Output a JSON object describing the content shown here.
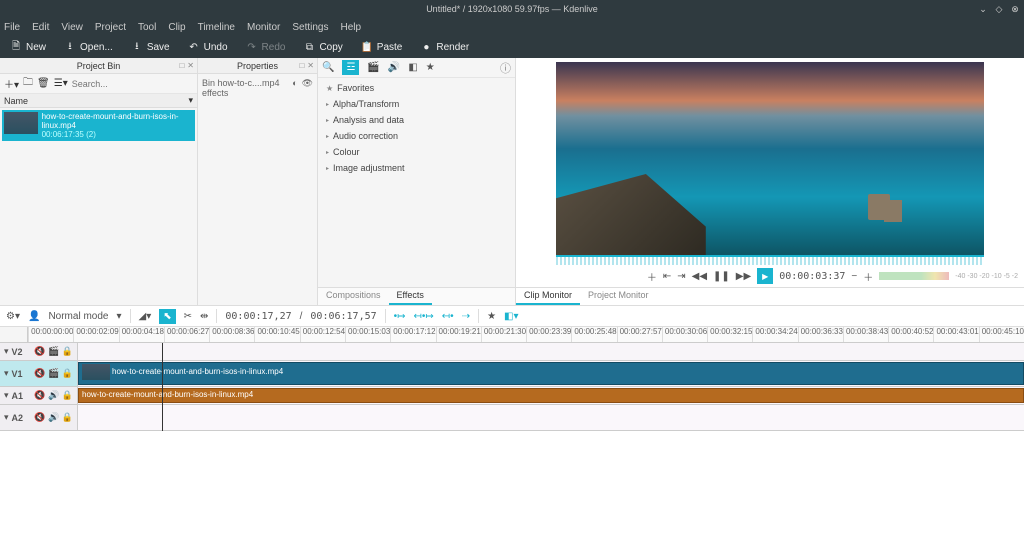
{
  "window": {
    "title": "Untitled* / 1920x1080 59.97fps — Kdenlive"
  },
  "menu": [
    "File",
    "Edit",
    "View",
    "Project",
    "Tool",
    "Clip",
    "Timeline",
    "Monitor",
    "Settings",
    "Help"
  ],
  "toolbar": {
    "new": "New",
    "open": "Open...",
    "save": "Save",
    "undo": "Undo",
    "redo": "Redo",
    "copy": "Copy",
    "paste": "Paste",
    "render": "Render"
  },
  "bin": {
    "title": "Project Bin",
    "search_ph": "Search...",
    "col": "Name",
    "clip": {
      "name": "how-to-create-mount-and-burn-isos-in-linux.mp4",
      "dur": "00:06:17:35 (2)"
    }
  },
  "props": {
    "title": "Properties",
    "text": "Bin how-to-c....mp4 effects"
  },
  "effects": {
    "categories": [
      "Favorites",
      "Alpha/Transform",
      "Analysis and data",
      "Audio correction",
      "Colour",
      "Image adjustment"
    ],
    "tabs": {
      "comp": "Compositions",
      "eff": "Effects"
    }
  },
  "monitor": {
    "timecode": "00:00:03:37",
    "tabs": {
      "clip": "Clip Monitor",
      "proj": "Project Monitor"
    },
    "scale": [
      "-40",
      "-30",
      "-20",
      "-10",
      "-5",
      "-2"
    ]
  },
  "tl_tools": {
    "mode": "Normal mode",
    "pos": "00:00:17,27",
    "dur": "00:06:17,57"
  },
  "ruler": [
    "00:00:00:00",
    "00:00:02:09",
    "00:00:04:18",
    "00:00:06:27",
    "00:00:08:36",
    "00:00:10:45",
    "00:00:12:54",
    "00:00:15:03",
    "00:00:17:12",
    "00:00:19:21",
    "00:00:21:30",
    "00:00:23:39",
    "00:00:25:48",
    "00:00:27:57",
    "00:00:30:06",
    "00:00:32:15",
    "00:00:34:24",
    "00:00:36:33",
    "00:00:38:43",
    "00:00:40:52",
    "00:00:43:01",
    "00:00:45:10"
  ],
  "tracks": {
    "v2": "V2",
    "v1": "V1",
    "a1": "A1",
    "a2": "A2"
  },
  "tl_clip": {
    "video": "how-to-create-mount-and-burn-isos-in-linux.mp4",
    "audio": "how-to-create-mount-and-burn-isos-in-linux.mp4"
  }
}
